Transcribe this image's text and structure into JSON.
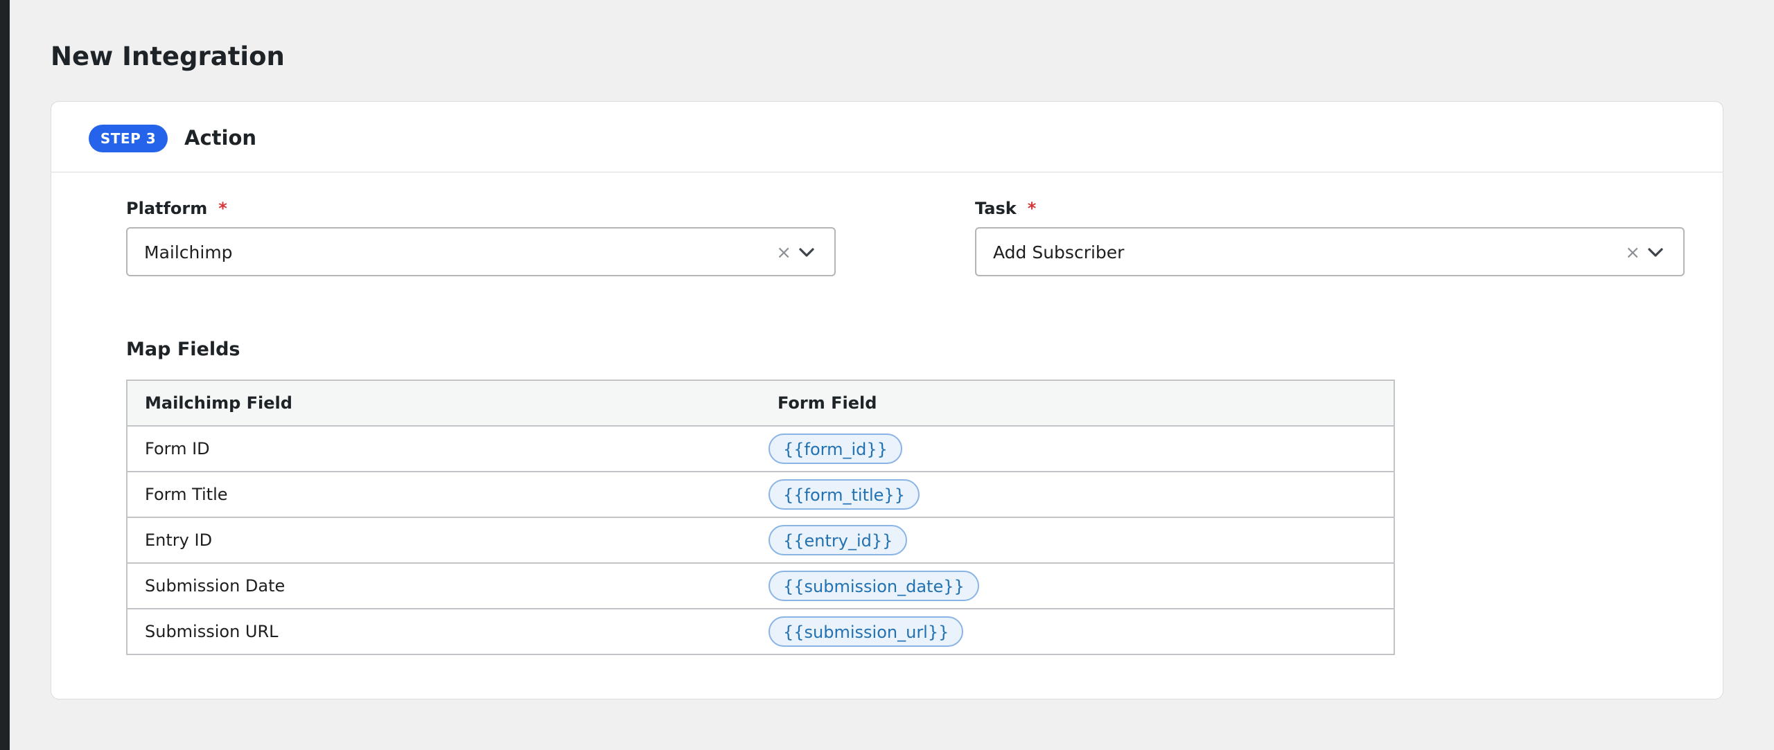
{
  "page": {
    "title": "New Integration"
  },
  "step": {
    "badge": "STEP 3",
    "title": "Action"
  },
  "platform": {
    "label": "Platform",
    "required_mark": "*",
    "value": "Mailchimp",
    "clear_glyph": "×",
    "icon": "chevron-down-icon"
  },
  "task": {
    "label": "Task",
    "required_mark": "*",
    "value": "Add Subscriber",
    "clear_glyph": "×",
    "icon": "chevron-down-icon"
  },
  "map_fields": {
    "title": "Map Fields",
    "columns": [
      "Mailchimp Field",
      "Form Field"
    ],
    "rows": [
      {
        "field": "Form ID",
        "token": "{{form_id}}"
      },
      {
        "field": "Form Title",
        "token": "{{form_title}}"
      },
      {
        "field": "Entry ID",
        "token": "{{entry_id}}"
      },
      {
        "field": "Submission Date",
        "token": "{{submission_date}}"
      },
      {
        "field": "Submission URL",
        "token": "{{submission_url}}"
      }
    ]
  },
  "colors": {
    "accent": "#2563eb",
    "required": "#d63638",
    "token_text": "#2271b1",
    "token_bg": "#eaf2fb",
    "token_border": "#8ab4e6"
  }
}
